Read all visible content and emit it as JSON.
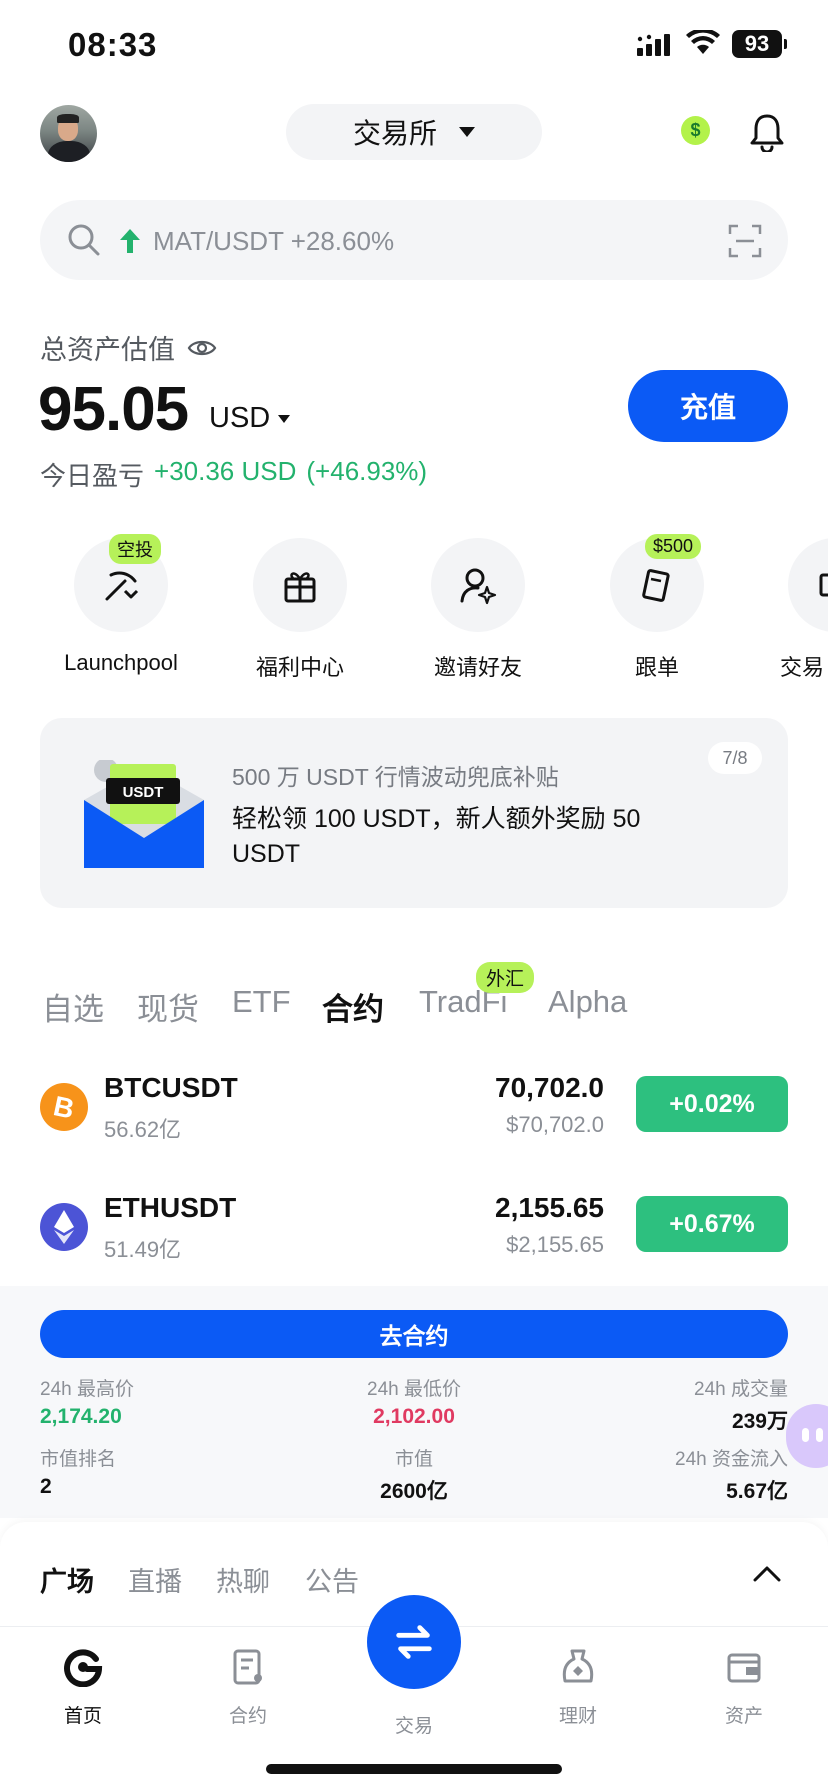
{
  "status_bar": {
    "time": "08:33",
    "battery": "93"
  },
  "header": {
    "exchange_label": "交易所"
  },
  "search": {
    "trend_text": "MAT/USDT +28.60%"
  },
  "assets": {
    "title": "总资产估值",
    "value": "95.05",
    "currency": "USD",
    "pnl_label": "今日盈亏",
    "pnl_value": "+30.36 USD",
    "pnl_percent": "(+46.93%)",
    "deposit_label": "充值"
  },
  "shortcuts": [
    {
      "label": "Launchpool",
      "tag": "空投",
      "icon": "pickaxe-icon"
    },
    {
      "label": "福利中心",
      "tag": "",
      "icon": "gift-icon"
    },
    {
      "label": "邀请好友",
      "tag": "",
      "icon": "invite-user-icon"
    },
    {
      "label": "跟单",
      "tag": "$500",
      "icon": "copy-trade-icon"
    },
    {
      "label": "交易",
      "tag": "",
      "icon": "trade-icon"
    }
  ],
  "banner": {
    "subtitle": "500 万 USDT 行情波动兜底补贴",
    "title": "轻松领 100 USDT，新人额外奖励 50 USDT",
    "pager": "7/8",
    "art_text": "USDT"
  },
  "market_tabs": [
    "自选",
    "现货",
    "ETF",
    "合约",
    "TradFi",
    "Alpha"
  ],
  "market_tab_badge": "外汇",
  "market_rows": [
    {
      "symbol": "BTCUSDT",
      "volume": "56.62亿",
      "price": "70,702.0",
      "usd_price": "$70,702.0",
      "change": "+0.02%",
      "icon": "bitcoin-icon"
    },
    {
      "symbol": "ETHUSDT",
      "volume": "51.49亿",
      "price": "2,155.65",
      "usd_price": "$2,155.65",
      "change": "+0.67%",
      "icon": "ethereum-icon"
    }
  ],
  "futures_panel": {
    "button_label": "去合约",
    "stats": [
      {
        "key": "24h 最高价",
        "value": "2,174.20"
      },
      {
        "key": "24h 最低价",
        "value": "2,102.00"
      },
      {
        "key": "24h 成交量",
        "value": "239万"
      },
      {
        "key": "市值排名",
        "value": "2"
      },
      {
        "key": "市值",
        "value": "2600亿"
      },
      {
        "key": "24h 资金流入",
        "value": "5.67亿"
      }
    ]
  },
  "community_tabs": [
    "广场",
    "直播",
    "热聊",
    "公告"
  ],
  "bottom_nav": [
    {
      "label": "首页",
      "icon": "home-icon"
    },
    {
      "label": "合约",
      "icon": "contract-icon"
    },
    {
      "label": "交易",
      "icon": "swap-icon"
    },
    {
      "label": "理财",
      "icon": "earn-icon"
    },
    {
      "label": "资产",
      "icon": "wallet-icon"
    }
  ],
  "colors": {
    "accent": "#0b5af5",
    "up": "#2dc07f",
    "down": "#e03a61",
    "badge": "#b6f159"
  }
}
